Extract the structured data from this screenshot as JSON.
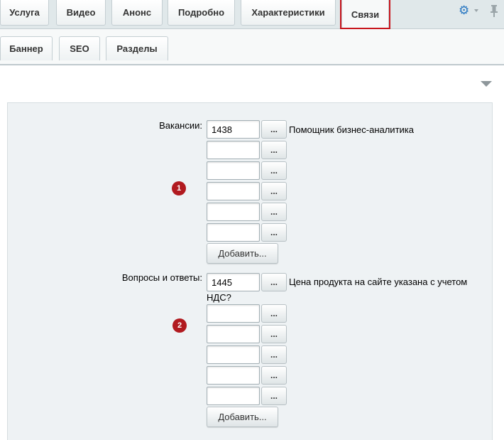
{
  "top_tabs": [
    {
      "label": "Услуга",
      "active": false
    },
    {
      "label": "Видео",
      "active": false
    },
    {
      "label": "Анонс",
      "active": false
    },
    {
      "label": "Подробно",
      "active": false
    },
    {
      "label": "Характеристики",
      "active": false
    },
    {
      "label": "Связи",
      "active": true
    }
  ],
  "toolbar_icons": [
    "gear-icon",
    "pin-icon"
  ],
  "sub_tabs": [
    {
      "label": "Баннер"
    },
    {
      "label": "SEO"
    },
    {
      "label": "Разделы"
    }
  ],
  "vacancies": {
    "label": "Вакансии:",
    "rows": [
      {
        "value": "1438",
        "name": "Помощник бизнес-аналитика"
      },
      {
        "value": "",
        "name": ""
      },
      {
        "value": "",
        "name": ""
      },
      {
        "value": "",
        "name": ""
      },
      {
        "value": "",
        "name": ""
      },
      {
        "value": "",
        "name": ""
      }
    ],
    "browse_label": "...",
    "add_label": "Добавить...",
    "badge": "1"
  },
  "faq": {
    "label": "Вопросы и ответы:",
    "rows": [
      {
        "value": "1445",
        "name": "Цена продукта на сайте указана с учетом",
        "name_cont": "НДС?"
      },
      {
        "value": "",
        "name": ""
      },
      {
        "value": "",
        "name": ""
      },
      {
        "value": "",
        "name": ""
      },
      {
        "value": "",
        "name": ""
      },
      {
        "value": "",
        "name": ""
      }
    ],
    "browse_label": "...",
    "add_label": "Добавить...",
    "badge": "2"
  },
  "colors": {
    "active_highlight": "#c8161d",
    "badge": "#b11a1f",
    "gear": "#2a78c2"
  }
}
